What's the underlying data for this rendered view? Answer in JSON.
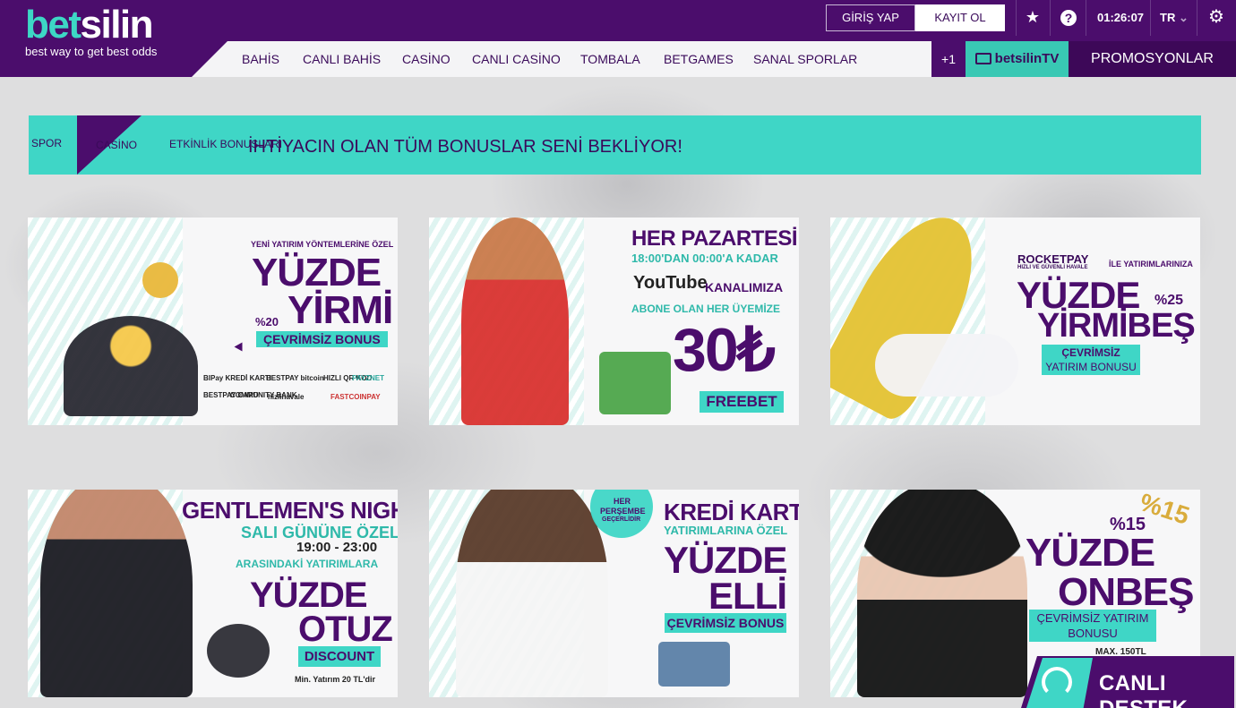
{
  "header": {
    "logo_a": "bet",
    "logo_b": "silin",
    "tagline": "best way to get best odds",
    "login": "GİRİŞ YAP",
    "register": "KAYIT OL",
    "time": "01:26:07",
    "lang": "TR",
    "nav": [
      "BAHİS",
      "CANLI BAHİS",
      "CASİNO",
      "CANLI CASİNO",
      "TOMBALA",
      "BETGAMES",
      "SANAL SPORLAR"
    ],
    "plus": "+1",
    "tv_label": "betsilinTV",
    "promo": "PROMOSYONLAR"
  },
  "banner": {
    "tabs": [
      "SPOR",
      "CASİNO",
      "ETKİNLİK BONUSLARI"
    ],
    "title": "İHTİYACIN OLAN TÜM BONUSLAR SENİ BEKLİYOR!"
  },
  "cards": [
    {
      "l1": "YENİ YATIRIM YÖNTEMLERİNE ÖZEL",
      "l2": "YÜZDE",
      "pct": "%20",
      "l3": "YİRMİ",
      "chip": "ÇEVRİMSİZ BONUS",
      "logos": [
        "BIPay KREDİ KARTI",
        "BESTPAY bitcoin",
        "HIZLI QR KOD",
        "PAYZNET",
        "BESTPAY CARD",
        "COMMUNITY BANK",
        "hizlihavale",
        "FASTCOINPAY"
      ]
    },
    {
      "l1": "HER PAZARTESİ",
      "l2": "18:00'DAN 00:00'A KADAR",
      "yt": "YouTube",
      "l3": "KANALIMIZA",
      "l4": "ABONE OLAN HER ÜYEMİZE",
      "amount": "30₺",
      "chip": "FREEBET"
    },
    {
      "brand": "ROCKETPAY",
      "brand_sub": "HIZLI VE GÜVENLİ HAVALE",
      "l1": "İLE YATIRIMLARINIZA",
      "l2": "YÜZDE",
      "pct": "%25",
      "l3": "YİRMİBEŞ",
      "chip1": "ÇEVRİMSİZ",
      "chip2": "YATIRIM BONUSU"
    },
    {
      "l1": "GENTLEMEN'S NIGHT",
      "l2": "SALI GÜNÜNE ÖZEL",
      "l3": "19:00 - 23:00",
      "l4": "ARASINDAKİ YATIRIMLARA",
      "l5": "YÜZDE",
      "l6": "OTUZ",
      "chip": "DISCOUNT",
      "note": "Min. Yatırım 20 TL'dir"
    },
    {
      "badge1": "HER",
      "badge2": "PERŞEMBE",
      "badge3": "GEÇERLİDİR",
      "l1": "KREDİ KARTI",
      "l2": "YATIRIMLARINA ÖZEL",
      "l3": "YÜZDE",
      "l4": "ELLİ",
      "chip": "ÇEVRİMSİZ BONUS"
    },
    {
      "pct": "%15",
      "l1": "YÜZDE",
      "l2": "ONBEŞ",
      "chip1": "ÇEVRİMSİZ YATIRIM",
      "chip2": "BONUSU",
      "note": "MAX. 150TL",
      "deco": "%15"
    }
  ],
  "support": {
    "label": "CANLI DESTEK"
  },
  "colors": {
    "purple": "#4b0d6c",
    "teal": "#3fd6c6"
  }
}
